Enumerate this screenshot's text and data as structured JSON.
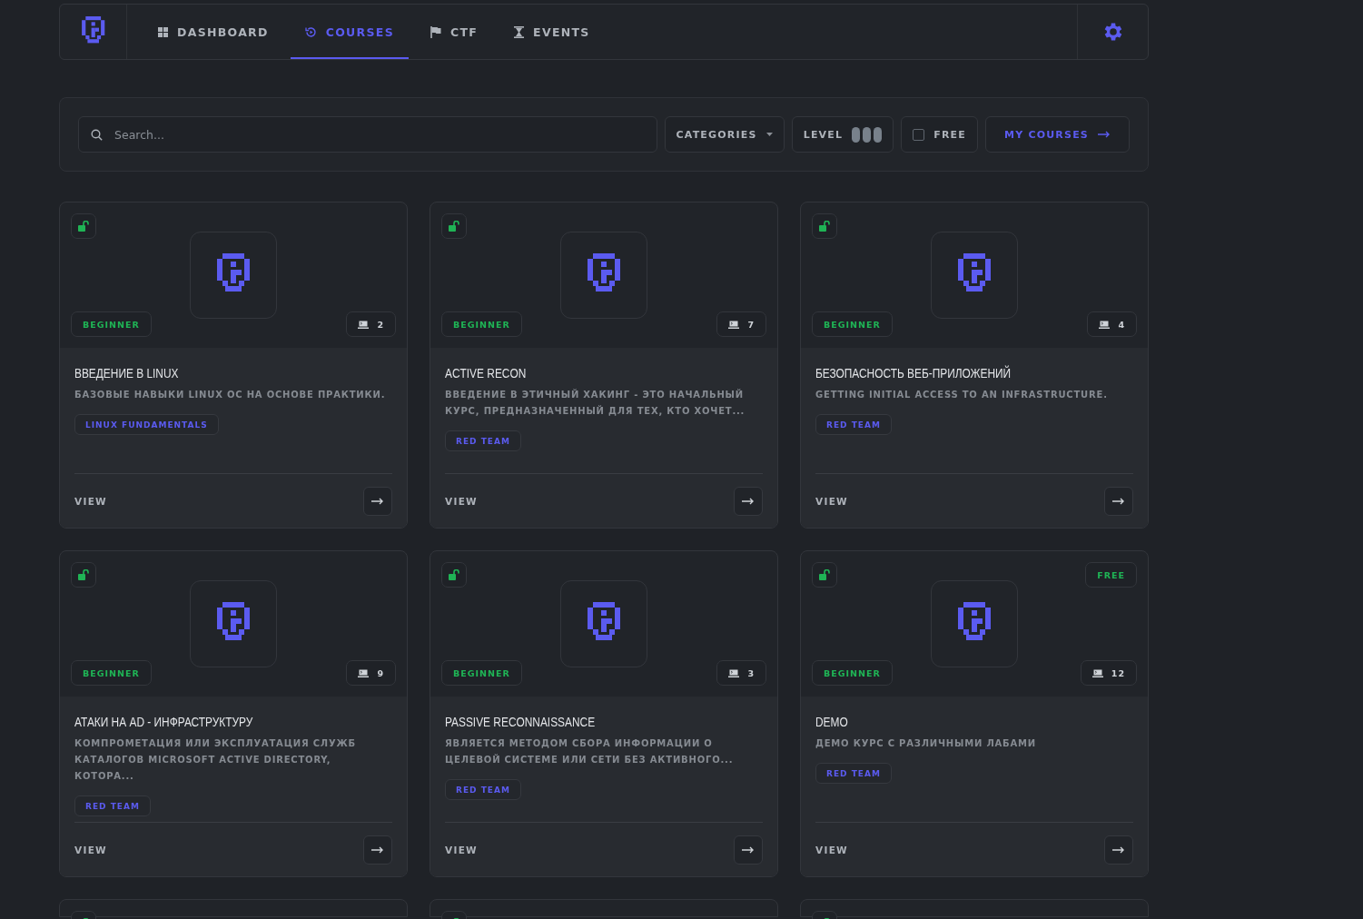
{
  "nav": {
    "tabs": [
      {
        "label": "DASHBOARD",
        "kind": "grid",
        "selected": false
      },
      {
        "label": "COURSES",
        "kind": "play",
        "selected": true
      },
      {
        "label": "CTF",
        "kind": "flag",
        "selected": false
      },
      {
        "label": "EVENTS",
        "kind": "hourglass",
        "selected": false
      }
    ]
  },
  "filters": {
    "search": {
      "placeholder": "Search..."
    },
    "categories": "CATEGORIES",
    "level": "LEVEL",
    "free": {
      "label": "FREE",
      "checked": false
    },
    "my_courses": "MY COURSES"
  },
  "cards": [
    {
      "unlocked": true,
      "level_badge": "BEGINNER",
      "labs": "2",
      "title": "ВВЕДЕНИЕ В LINUX",
      "description": "БАЗОВЫЕ НАВЫКИ LINUX ОС НА ОСНОВЕ ПРАКТИКИ.",
      "tag": "LINUX FUNDAMENTALS",
      "action": "VIEW"
    },
    {
      "unlocked": true,
      "level_badge": "BEGINNER",
      "labs": "7",
      "title": "ACTIVE RECON",
      "description": "ВВЕДЕНИЕ В ЭТИЧНЫЙ ХАКИНГ - ЭТО НАЧАЛЬНЫЙ КУРС, ПРЕДНАЗНАЧЕННЫЙ ДЛЯ ТЕХ, КТО ХОЧЕТ...",
      "tag": "RED TEAM",
      "action": "VIEW"
    },
    {
      "unlocked": true,
      "level_badge": "BEGINNER",
      "labs": "4",
      "title": "БЕЗОПАСНОСТЬ ВЕБ-ПРИЛОЖЕНИЙ",
      "description": "GETTING INITIAL ACCESS TO AN INFRASTRUCTURE.",
      "tag": "RED TEAM",
      "action": "VIEW"
    },
    {
      "unlocked": true,
      "level_badge": "BEGINNER",
      "labs": "9",
      "title": "АТАКИ НА AD - ИНФРАСТРУКТУРУ",
      "description": "КОМПРОМЕТАЦИЯ ИЛИ ЭКСПЛУАТАЦИЯ СЛУЖБ КАТАЛОГОВ MICROSOFT ACTIVE DIRECTORY, КОТОРА...",
      "tag": "RED TEAM",
      "action": "VIEW"
    },
    {
      "unlocked": true,
      "level_badge": "BEGINNER",
      "labs": "3",
      "title": "PASSIVE RECONNAISSANCE",
      "description": "ЯВЛЯЕТСЯ МЕТОДОМ СБОРА ИНФОРМАЦИИ О ЦЕЛЕВОЙ СИСТЕМЕ ИЛИ СЕТИ БЕЗ АКТИВНОГО...",
      "tag": "RED TEAM",
      "action": "VIEW"
    },
    {
      "unlocked": true,
      "free_badge": "FREE",
      "level_badge": "BEGINNER",
      "labs": "12",
      "title": "DEMO",
      "description": "ДЕМО КУРС С РАЗЛИЧНЫМИ ЛАБАМИ",
      "tag": "RED TEAM",
      "action": "VIEW"
    }
  ],
  "more_cards": [
    {
      "unlocked": true
    },
    {
      "unlocked": true
    },
    {
      "unlocked": true
    }
  ]
}
